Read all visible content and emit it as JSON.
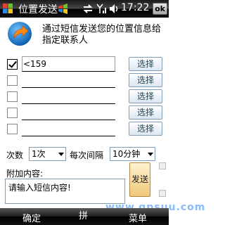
{
  "titlebar": {
    "title": "位置发送",
    "clock": "17:22",
    "ok_label": "ok",
    "icons": [
      "windows-flag-icon",
      "sync-icon",
      "signal-icon",
      "volume-icon"
    ]
  },
  "header": {
    "description": "通过短信发送您的位置信息给指定联系人",
    "logo_icon": "send-location-arrow-icon",
    "accent": "#1a7fd6"
  },
  "contacts": [
    {
      "checked": true,
      "value": "<159",
      "button": "选择"
    },
    {
      "checked": false,
      "value": "",
      "button": "选择"
    },
    {
      "checked": false,
      "value": "",
      "button": "选择"
    },
    {
      "checked": false,
      "value": "",
      "button": "选择"
    },
    {
      "checked": false,
      "value": "",
      "button": "选择"
    }
  ],
  "settings": {
    "count_label": "次数",
    "count_value": "1次",
    "interval_label": "每次间隔",
    "interval_value": "10分钟"
  },
  "message": {
    "label": "附加内容:",
    "value": "请输入短信内容!",
    "send_label": "发送"
  },
  "watermark": "www.gpsuu.com",
  "menubar": {
    "left": "确定",
    "center": "拼",
    "right": "菜单"
  }
}
